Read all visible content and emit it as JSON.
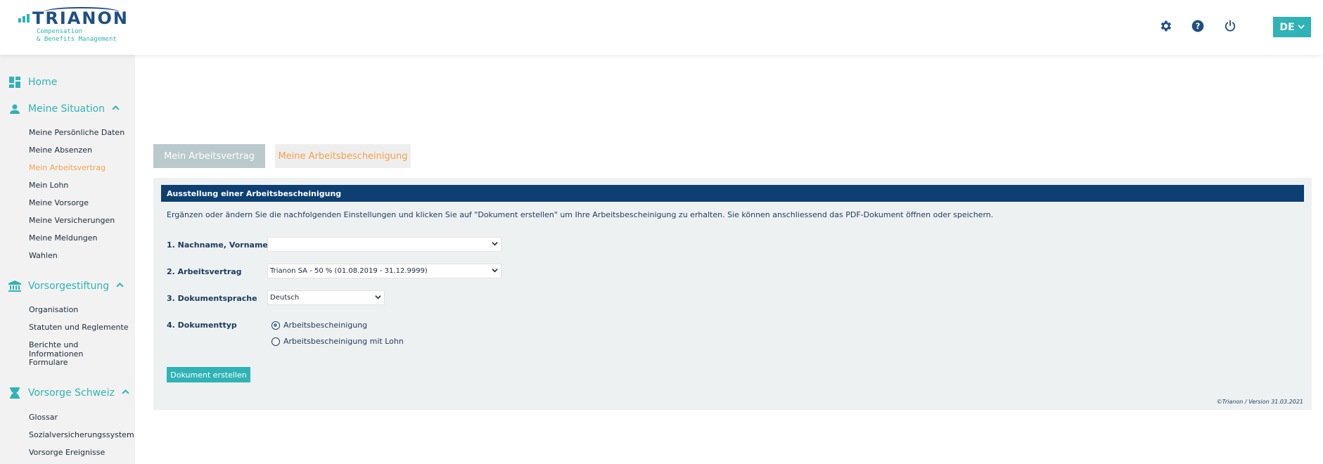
{
  "header": {
    "logo_word": "TRIANON",
    "logo_sub_1": "Compensation",
    "logo_sub_2": "& Benefits Management",
    "icons": [
      "gear-icon",
      "help-icon",
      "power-icon"
    ],
    "language": "DE",
    "brand_color": "#2fb3b6",
    "navy_color": "#0d3f72"
  },
  "sidebar": {
    "home": "Home",
    "meine_situation": {
      "label": "Meine Situation",
      "items": [
        "Meine Persönliche Daten",
        "Meine Absenzen",
        "Mein Arbeitsvertrag",
        "Mein Lohn",
        "Meine Vorsorge",
        "Meine Versicherungen",
        "Meine Meldungen",
        "Wahlen"
      ],
      "active": "Mein Arbeitsvertrag"
    },
    "vorsorgestiftung": {
      "label": "Vorsorgestiftung",
      "items": [
        "Organisation",
        "Statuten und Reglemente",
        "Berichte und Informationen",
        "Formulare"
      ]
    },
    "vorsorge_schweiz": {
      "label": "Vorsorge Schweiz",
      "items": [
        "Glossar",
        "Sozialversicherungssystem",
        "Vorsorge Ereignisse"
      ]
    }
  },
  "tabs": [
    "Mein Arbeitsvertrag",
    "Meine Arbeitsbescheinigung"
  ],
  "form": {
    "title": "Ausstellung einer Arbeitsbescheinigung",
    "intro": "Ergänzen oder ändern Sie die nachfolgenden Einstellungen und klicken Sie auf \"Dokument erstellen\" um Ihre Arbeitsbescheinigung zu erhalten. Sie können anschliessend das PDF-Dokument öffnen oder speichern.",
    "field1_label": "1. Nachname, Vorname",
    "field1_value": "",
    "field2_label": "2. Arbeitsvertrag",
    "field2_value": "Trianon SA - 50 % (01.08.2019 - 31.12.9999)",
    "field3_label": "3. Dokumentsprache",
    "field3_value": "Deutsch",
    "field4_label": "4. Dokumenttyp",
    "radio_options": [
      "Arbeitsbescheinigung",
      "Arbeitsbescheinigung mit Lohn"
    ],
    "radio_selected": "Arbeitsbescheinigung",
    "submit": "Dokument erstellen",
    "footer": "©Trianon / Version 31.03.2021"
  }
}
